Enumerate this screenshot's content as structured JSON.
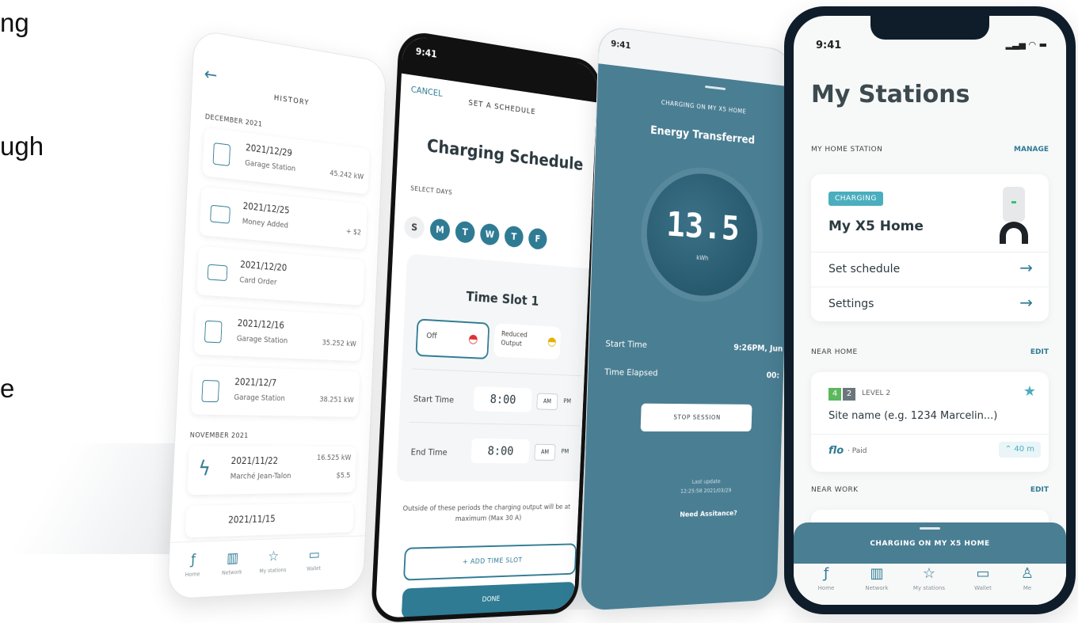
{
  "side_text": {
    "line1": "ng",
    "line2": "ugh",
    "line3": "e"
  },
  "history": {
    "title": "HISTORY",
    "dec": "DECEMBER 2021",
    "nov": "NOVEMBER 2021",
    "items": [
      {
        "date": "2021/12/29",
        "title": "Garage Station",
        "amount": "45.242 kW"
      },
      {
        "date": "2021/12/25",
        "title": "Money Added",
        "amount": "+ $2"
      },
      {
        "date": "2021/12/20",
        "title": "Card Order",
        "amount": ""
      },
      {
        "date": "2021/12/16",
        "title": "Garage Station",
        "amount": "35.252 kW"
      },
      {
        "date": "2021/12/7",
        "title": "Garage Station",
        "amount": "38.251 kW"
      },
      {
        "date": "2021/11/22",
        "title": "Marché Jean-Talon",
        "amount": "16.525 kW"
      },
      {
        "date": "2021/11/15",
        "title": "",
        "amount": ""
      }
    ],
    "amount_2": "$5.5",
    "nav": [
      "Home",
      "Network",
      "My stations",
      "Wallet"
    ]
  },
  "schedule": {
    "time": "9:41",
    "cancel": "CANCEL",
    "title": "SET A SCHEDULE",
    "heading": "Charging Schedule",
    "select_days": "SELECT DAYS",
    "days": [
      "S",
      "M",
      "T",
      "W",
      "T",
      "F"
    ],
    "slot_title": "Time Slot 1",
    "off": "Off",
    "reduced": "Reduced Output",
    "start_label": "Start Time",
    "start_value": "8:00",
    "end_label": "End Time",
    "end_value": "8:00",
    "am": "AM",
    "pm": "PM",
    "note": "Outside of these periods the charging output will be at maximum (Max 30 A)",
    "add": "+ ADD TIME SLOT",
    "done": "DONE"
  },
  "energy": {
    "time": "9:41",
    "header": "CHARGING ON MY X5 HOME",
    "title": "Energy Transferred",
    "value": "13.5",
    "unit": "kWh",
    "start_label": "Start Time",
    "start_value": "9:26PM, Jun",
    "elapsed_label": "Time Elapsed",
    "elapsed_value": "00:",
    "stop": "STOP SESSION",
    "last_update_1": "Last update",
    "last_update_2": "12:25:58 2021/03/29",
    "help": "Need Assitance?"
  },
  "stations": {
    "time": "9:41",
    "title": "My Stations",
    "home_label": "MY HOME STATION",
    "manage": "MANAGE",
    "badge": "CHARGING",
    "home_name": "My X5 Home",
    "set_schedule": "Set schedule",
    "settings": "Settings",
    "near_home": "NEAR HOME",
    "edit": "EDIT",
    "n1": "4",
    "n2": "2",
    "level": "LEVEL 2",
    "site": "Site name (e.g. 1234 Marcelin...)",
    "brand": "flo",
    "paid": "· Paid",
    "distance": "40 m",
    "near_work": "NEAR WORK",
    "charging_bar": "CHARGING ON MY X5 HOME",
    "nav": [
      "Home",
      "Network",
      "My stations",
      "Wallet",
      "Me"
    ]
  }
}
